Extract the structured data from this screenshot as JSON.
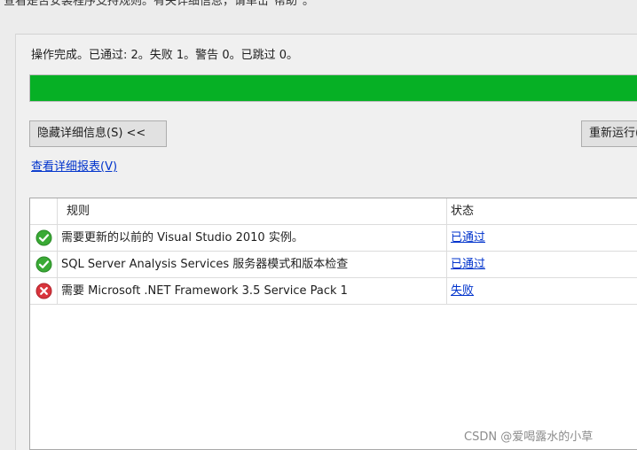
{
  "top_banner": {
    "clipped_text": "查看是否安装程序支持规则。有关详细信息，请单击\"帮助\"。"
  },
  "status_line": "操作完成。已通过: 2。失败 1。警告 0。已跳过 0。",
  "progress": {
    "percent": 100,
    "color": "#06b025"
  },
  "buttons": {
    "hide_details": "隐藏详细信息(S) <<",
    "rerun": "重新运行(R)"
  },
  "report_link": "查看详细报表(V)",
  "table": {
    "headers": {
      "rule": "规则",
      "status": "状态"
    },
    "rows": [
      {
        "icon": "success-check-icon",
        "rule": "需要更新的以前的 Visual Studio 2010 实例。",
        "status": "已通过"
      },
      {
        "icon": "success-check-icon",
        "rule": "SQL Server Analysis Services 服务器模式和版本检查",
        "status": "已通过"
      },
      {
        "icon": "error-x-icon",
        "rule": "需要 Microsoft .NET Framework 3.5 Service Pack 1",
        "status": "失败"
      }
    ]
  },
  "watermark": "CSDN @爱喝露水的小草",
  "colors": {
    "link": "#0033cc",
    "success": "#3aaa35",
    "error": "#d9343c"
  }
}
